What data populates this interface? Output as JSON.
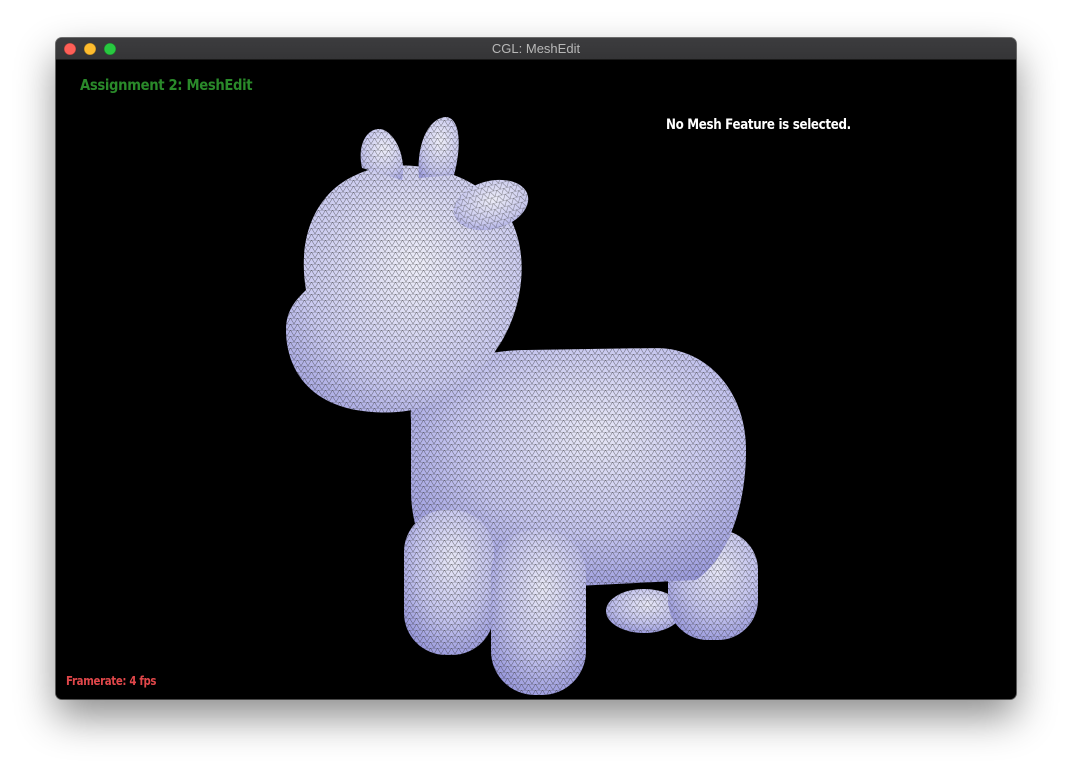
{
  "window": {
    "title": "CGL: MeshEdit",
    "controls": [
      "close-button",
      "minimize-button",
      "zoom-button"
    ]
  },
  "hud": {
    "assignment_title": "Assignment 2: MeshEdit",
    "selection_status": "No Mesh Feature is selected.",
    "framerate": "Framerate: 4 fps"
  },
  "scene": {
    "model": "cow",
    "render_mode": "shaded-with-wireframe",
    "background_color": "#000000",
    "mesh_fill_color": "#b3b3ea",
    "wireframe_color": "#2b2b2b"
  },
  "colors": {
    "title_green": "#2a8a2a",
    "status_white": "#ffffff",
    "framerate_red": "#e0474a"
  }
}
